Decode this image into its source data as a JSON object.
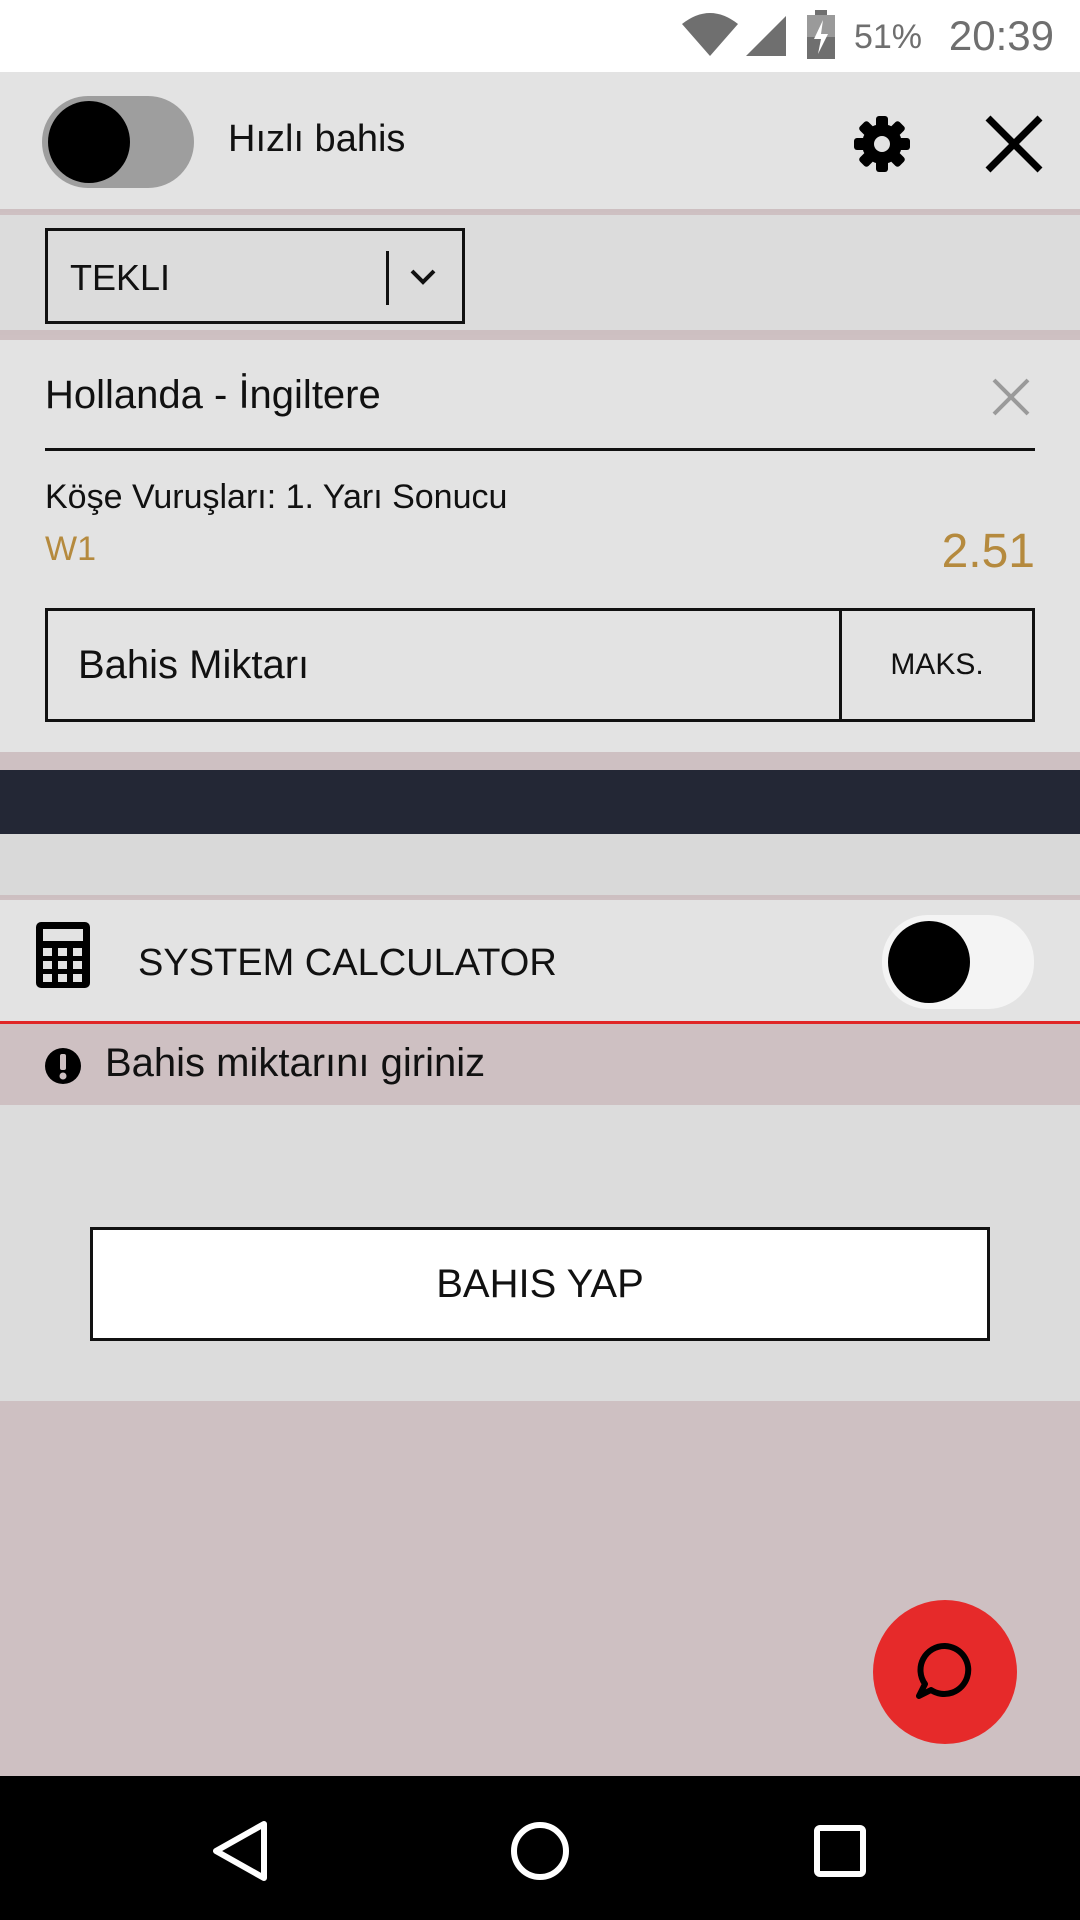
{
  "status_bar": {
    "battery_percent": "51%",
    "time": "20:39"
  },
  "header": {
    "quick_bet_label": "Hızlı bahis",
    "quick_bet_enabled": false
  },
  "bet_type": {
    "selected": "TEKLI"
  },
  "bet": {
    "match": "Hollanda - İngiltere",
    "market": "Köşe Vuruşları: 1. Yarı Sonucu",
    "outcome": "W1",
    "odds": "2.51",
    "stake_placeholder": "Bahis Miktarı",
    "max_label": "MAKS."
  },
  "system_calculator": {
    "label": "SYSTEM CALCULATOR",
    "enabled": false
  },
  "error": {
    "message": "Bahis miktarını giriniz"
  },
  "actions": {
    "place_bet_label": "BAHIS YAP"
  },
  "colors": {
    "accent_gold": "#b58a3e",
    "error_red": "#e02626",
    "fab_red": "#e62a2a",
    "dark_strip": "#232735"
  }
}
